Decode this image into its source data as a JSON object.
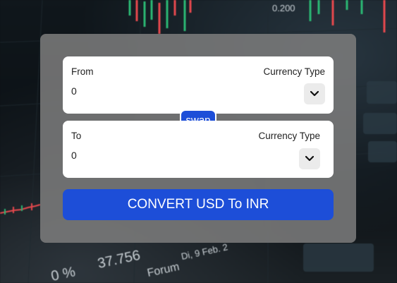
{
  "from": {
    "label": "From",
    "currency_type_label": "Currency Type",
    "amount": "0"
  },
  "to": {
    "label": "To",
    "currency_type_label": "Currency Type",
    "amount": "0"
  },
  "swap_label": "swap",
  "convert_label": "CONVERT USD To INR",
  "background_text": {
    "percent": "0 %",
    "price": "37.756",
    "forum": "Forum",
    "date": "Di, 9 Feb. 2",
    "top_value": "0.200"
  },
  "colors": {
    "accent": "#1d4ed8",
    "card": "#7d7d7d",
    "panel": "#ffffff",
    "candle_up": "#2bb673",
    "candle_down": "#e5484d"
  },
  "icons": {
    "select_arrow": "chevron-down-icon"
  }
}
